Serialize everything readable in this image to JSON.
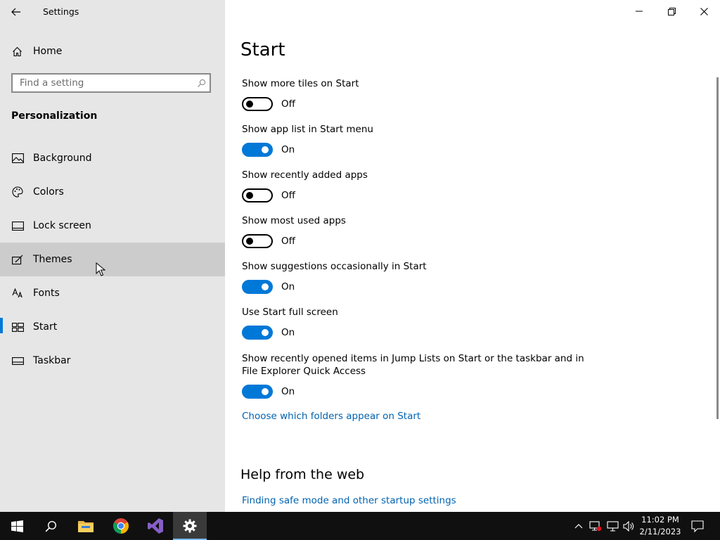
{
  "window": {
    "title": "Settings",
    "controls": {
      "minimize": "minimize-icon",
      "maximize": "restore-icon",
      "close": "close-icon"
    }
  },
  "sidebar": {
    "home_label": "Home",
    "search_placeholder": "Find a setting",
    "section_title": "Personalization",
    "items": [
      {
        "label": "Background",
        "icon": "picture-icon"
      },
      {
        "label": "Colors",
        "icon": "palette-icon"
      },
      {
        "label": "Lock screen",
        "icon": "lock-screen-icon"
      },
      {
        "label": "Themes",
        "icon": "brush-icon",
        "state": "hover"
      },
      {
        "label": "Fonts",
        "icon": "font-icon"
      },
      {
        "label": "Start",
        "icon": "start-icon",
        "state": "selected"
      },
      {
        "label": "Taskbar",
        "icon": "taskbar-icon"
      }
    ]
  },
  "main": {
    "title": "Start",
    "settings": [
      {
        "label": "Show more tiles on Start",
        "on": false,
        "state_label": "Off"
      },
      {
        "label": "Show app list in Start menu",
        "on": true,
        "state_label": "On"
      },
      {
        "label": "Show recently added apps",
        "on": false,
        "state_label": "Off"
      },
      {
        "label": "Show most used apps",
        "on": false,
        "state_label": "Off"
      },
      {
        "label": "Show suggestions occasionally in Start",
        "on": true,
        "state_label": "On"
      },
      {
        "label": "Use Start full screen",
        "on": true,
        "state_label": "On"
      },
      {
        "label_line1": "Show recently opened items in Jump Lists on Start or the taskbar and in",
        "label_line2": "File Explorer Quick Access",
        "on": true,
        "state_label": "On"
      }
    ],
    "folders_link": "Choose which folders appear on Start",
    "help_title": "Help from the web",
    "help_link": "Finding safe mode and other startup settings"
  },
  "taskbar": {
    "apps": [
      "windows-start-icon",
      "search-icon",
      "file-explorer-icon",
      "chrome-icon",
      "visual-studio-icon",
      "settings-gear-icon"
    ],
    "tray": [
      "chevron-up-icon",
      "network-warning-icon",
      "network-icon",
      "volume-icon"
    ],
    "time": "11:02 PM",
    "date": "2/11/2023",
    "notification": "action-center-icon"
  },
  "colors": {
    "accent": "#0078d7",
    "link": "#0063b1",
    "sidebar_bg": "#e6e6e6",
    "hover_bg": "#cccccc",
    "taskbar_bg": "#101010"
  }
}
